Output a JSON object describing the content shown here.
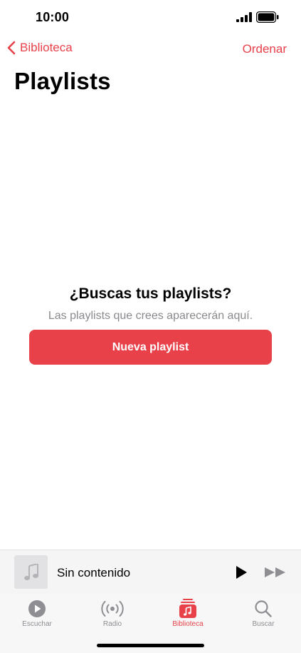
{
  "status_bar": {
    "time": "10:00"
  },
  "nav": {
    "back_label": "Biblioteca",
    "sort_label": "Ordenar"
  },
  "page": {
    "title": "Playlists"
  },
  "empty_state": {
    "title": "¿Buscas tus playlists?",
    "subtitle": "Las playlists que crees aparecerán aquí.",
    "button_label": "Nueva playlist"
  },
  "mini_player": {
    "track_title": "Sin contenido"
  },
  "tabs": [
    {
      "label": "Escuchar",
      "icon": "play-circle-icon",
      "active": false
    },
    {
      "label": "Radio",
      "icon": "radio-icon",
      "active": false
    },
    {
      "label": "Biblioteca",
      "icon": "library-icon",
      "active": true
    },
    {
      "label": "Buscar",
      "icon": "search-icon",
      "active": false
    }
  ],
  "colors": {
    "accent": "#e8414a",
    "inactive": "#8e8e93",
    "subtitle": "#8a8a8e"
  }
}
